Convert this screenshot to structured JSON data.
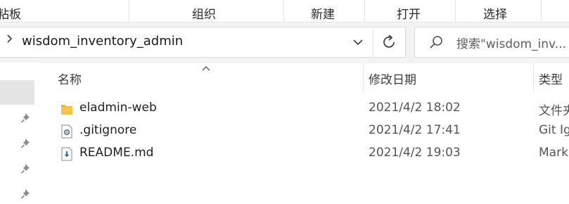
{
  "ribbon": {
    "groups": [
      "粘板",
      "组织",
      "新建",
      "打开",
      "选择"
    ]
  },
  "address": {
    "path": "wisdom_inventory_admin",
    "search_placeholder": "搜索\"wisdom_inv..."
  },
  "columns": {
    "name": "名称",
    "date": "修改日期",
    "type": "类型"
  },
  "files": [
    {
      "name": "eladmin-web",
      "date": "2021/4/2 18:02",
      "type": "文件夹",
      "icon": "folder-icon"
    },
    {
      "name": ".gitignore",
      "date": "2021/4/2 17:41",
      "type": "Git Ig",
      "icon": "settings-file-icon"
    },
    {
      "name": "README.md",
      "date": "2021/4/2 19:03",
      "type": "Mark",
      "icon": "download-file-icon"
    }
  ],
  "colors": {
    "folder": "#f4c54a",
    "selected_nav": "#e5e5e5"
  }
}
